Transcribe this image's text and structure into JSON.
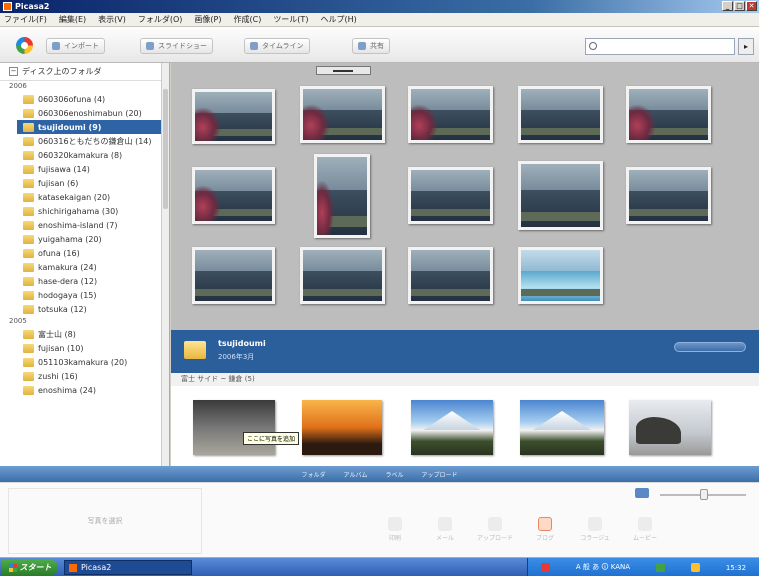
{
  "window": {
    "title": "Picasa2"
  },
  "menu": [
    "ファイル(F)",
    "編集(E)",
    "表示(V)",
    "フォルダ(O)",
    "画像(P)",
    "作成(C)",
    "ツール(T)",
    "ヘルプ(H)"
  ],
  "toolbar": {
    "buttons": [
      "インポート",
      "スライドショー",
      "タイムライン",
      "共有"
    ]
  },
  "sidebar": {
    "header": "ディスク上のフォルダ",
    "groups": [
      {
        "year": "2006",
        "items": [
          {
            "label": "060306ofuna (4)"
          },
          {
            "label": "060306enoshimabun (20)"
          },
          {
            "label": "tsujidoumi (9)",
            "selected": true
          },
          {
            "label": "060316ともだちの鎌倉山 (14)"
          },
          {
            "label": "060320kamakura (8)"
          },
          {
            "label": "fujisawa (14)"
          },
          {
            "label": "fujisan (6)"
          },
          {
            "label": "katasekaigan (20)"
          },
          {
            "label": "shichirigahama (30)"
          },
          {
            "label": "enoshima-island (7)"
          },
          {
            "label": "yuigahama (20)"
          },
          {
            "label": "ofuna (16)"
          },
          {
            "label": "kamakura (24)"
          },
          {
            "label": "hase-dera (12)"
          },
          {
            "label": "hodogaya (15)"
          },
          {
            "label": "totsuka (12)"
          }
        ]
      },
      {
        "year": "2005",
        "items": [
          {
            "label": "富士山 (8)"
          },
          {
            "label": "fujisan (10)"
          },
          {
            "label": "051103kamakura (20)"
          },
          {
            "label": "zushi (16)"
          },
          {
            "label": "enoshima (24)"
          }
        ]
      }
    ]
  },
  "album": {
    "name": "tsujidoumi",
    "date": "2006年3月",
    "sub": "富士 サイド ~ 鎌倉 (5)"
  },
  "tooltip": "ここに写真を追加",
  "bottom_strip": [
    "フォルダ",
    "アルバム",
    "ラベル",
    "アップロード"
  ],
  "tray": {
    "drop_label": "写真を選択",
    "actions": [
      "印刷",
      "メール",
      "アップロード",
      "ブログ",
      "コラージュ",
      "ムービー"
    ]
  },
  "taskbar": {
    "start": "スタート",
    "app": "Picasa2",
    "tray_text": "A 般 あ 🛈 KANA",
    "clock": "15:32"
  },
  "colors": {
    "accent": "#2b5f9b",
    "selection": "#2e64a5",
    "taskbar": "#2f5fb3"
  }
}
